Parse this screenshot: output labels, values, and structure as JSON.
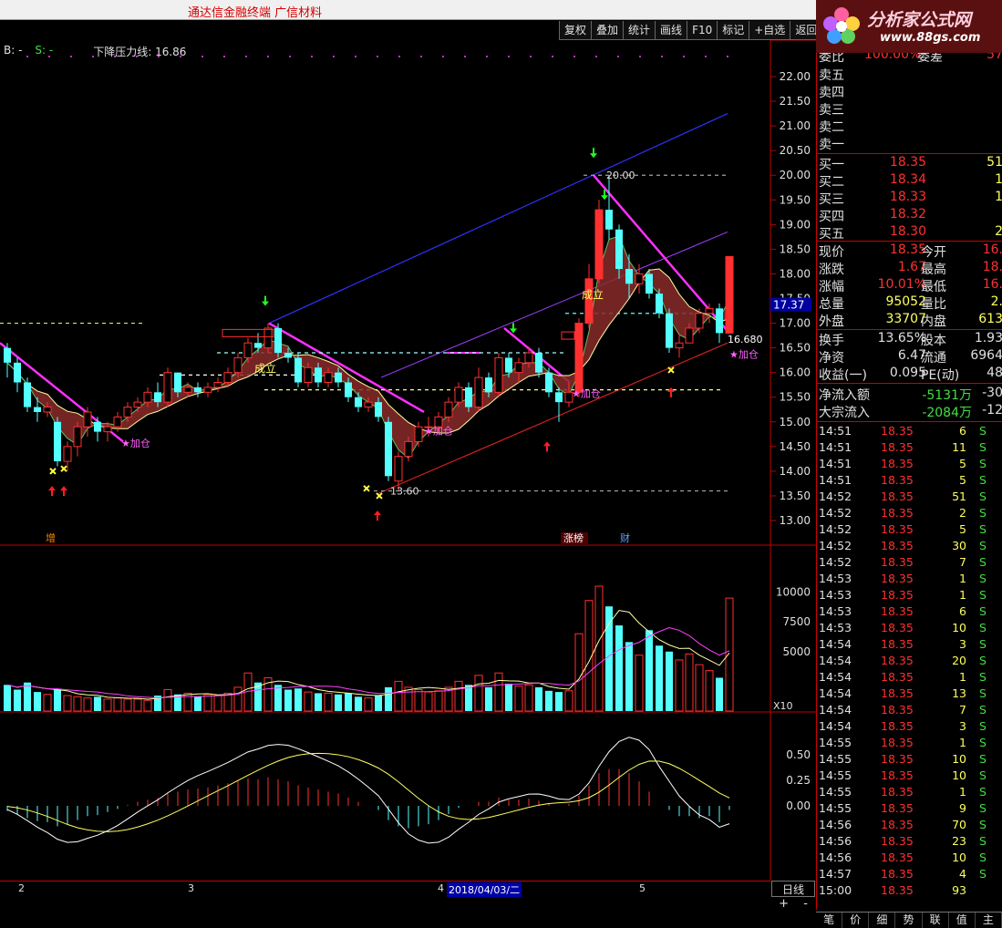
{
  "app": {
    "title": "通达信金融终端  广信材料"
  },
  "toolbar": [
    "复权",
    "叠加",
    "统计",
    "画线",
    "F10",
    "标记",
    "+自选",
    "返回"
  ],
  "logo": {
    "main": "分析家公式网",
    "url": "www.88gs.com"
  },
  "legend": {
    "b": "B: -",
    "s": "S: -",
    "line": "下降压力线: 16.86"
  },
  "price_axis": [
    "22.00",
    "21.50",
    "21.00",
    "20.50",
    "20.00",
    "19.50",
    "19.00",
    "18.50",
    "18.00",
    "17.50",
    "17.00",
    "16.50",
    "16.00",
    "15.50",
    "15.00",
    "14.50",
    "14.00",
    "13.50",
    "13.00"
  ],
  "current_price_tag": "17.37",
  "volume_axis": [
    "10000",
    "7500",
    "5000"
  ],
  "volume_unit": "X10",
  "macd_axis": [
    "0.50",
    "0.25",
    "0.00"
  ],
  "annotations": {
    "high": "20.00",
    "low": "13.60",
    "last": "16.680",
    "add_position": "★加仓",
    "established": "成立",
    "mark_zeng": "增",
    "mark_limit_up": "涨榜",
    "mark_cai": "财"
  },
  "dates": {
    "m2": "2",
    "m3": "3",
    "m4": "4",
    "cursor": "2018/04/03/二",
    "m5": "5"
  },
  "period": "日线",
  "zoom": {
    "plus": "+",
    "minus": "-"
  },
  "quote": {
    "weibi": {
      "label": "委比",
      "value": "100.00%",
      "label2": "委差",
      "value2": "57"
    },
    "sell": [
      {
        "label": "卖五"
      },
      {
        "label": "卖四"
      },
      {
        "label": "卖三"
      },
      {
        "label": "卖二"
      },
      {
        "label": "卖一"
      }
    ],
    "buy": [
      {
        "label": "买一",
        "price": "18.35",
        "vol": "51"
      },
      {
        "label": "买二",
        "price": "18.34",
        "vol": "1"
      },
      {
        "label": "买三",
        "price": "18.33",
        "vol": "1"
      },
      {
        "label": "买四",
        "price": "18.32",
        "vol": ""
      },
      {
        "label": "买五",
        "price": "18.30",
        "vol": "2"
      }
    ],
    "stats": [
      {
        "l1": "现价",
        "v1": "18.35",
        "l2": "今开",
        "v2": "16."
      },
      {
        "l1": "涨跌",
        "v1": "1.67",
        "l2": "最高",
        "v2": "18."
      },
      {
        "l1": "涨幅",
        "v1": "10.01%",
        "l2": "最低",
        "v2": "16."
      },
      {
        "l1": "总量",
        "v1": "95052",
        "l2": "量比",
        "v2": "2."
      },
      {
        "l1": "外盘",
        "v1": "33707",
        "l2": "内盘",
        "v2": "613"
      }
    ],
    "stats2": [
      {
        "l1": "换手",
        "v1": "13.65%",
        "l2": "股本",
        "v2": "1.93"
      },
      {
        "l1": "净资",
        "v1": "6.47",
        "l2": "流通",
        "v2": "6964"
      },
      {
        "l1": "收益(一)",
        "v1": "0.095",
        "l2": "PE(动)",
        "v2": "48"
      }
    ],
    "flow": [
      {
        "label": "净流入额",
        "value": "-5131万",
        "extra": "-30"
      },
      {
        "label": "大宗流入",
        "value": "-2084万",
        "extra": "-12"
      }
    ]
  },
  "ticks": [
    {
      "t": "14:51",
      "p": "18.35",
      "v": "6",
      "d": "S"
    },
    {
      "t": "14:51",
      "p": "18.35",
      "v": "11",
      "d": "S"
    },
    {
      "t": "14:51",
      "p": "18.35",
      "v": "5",
      "d": "S"
    },
    {
      "t": "14:51",
      "p": "18.35",
      "v": "5",
      "d": "S"
    },
    {
      "t": "14:52",
      "p": "18.35",
      "v": "51",
      "d": "S"
    },
    {
      "t": "14:52",
      "p": "18.35",
      "v": "2",
      "d": "S"
    },
    {
      "t": "14:52",
      "p": "18.35",
      "v": "5",
      "d": "S"
    },
    {
      "t": "14:52",
      "p": "18.35",
      "v": "30",
      "d": "S"
    },
    {
      "t": "14:52",
      "p": "18.35",
      "v": "7",
      "d": "S"
    },
    {
      "t": "14:53",
      "p": "18.35",
      "v": "1",
      "d": "S"
    },
    {
      "t": "14:53",
      "p": "18.35",
      "v": "1",
      "d": "S"
    },
    {
      "t": "14:53",
      "p": "18.35",
      "v": "6",
      "d": "S"
    },
    {
      "t": "14:53",
      "p": "18.35",
      "v": "10",
      "d": "S"
    },
    {
      "t": "14:54",
      "p": "18.35",
      "v": "3",
      "d": "S"
    },
    {
      "t": "14:54",
      "p": "18.35",
      "v": "20",
      "d": "S"
    },
    {
      "t": "14:54",
      "p": "18.35",
      "v": "1",
      "d": "S"
    },
    {
      "t": "14:54",
      "p": "18.35",
      "v": "13",
      "d": "S"
    },
    {
      "t": "14:54",
      "p": "18.35",
      "v": "7",
      "d": "S"
    },
    {
      "t": "14:54",
      "p": "18.35",
      "v": "3",
      "d": "S"
    },
    {
      "t": "14:55",
      "p": "18.35",
      "v": "1",
      "d": "S"
    },
    {
      "t": "14:55",
      "p": "18.35",
      "v": "10",
      "d": "S"
    },
    {
      "t": "14:55",
      "p": "18.35",
      "v": "10",
      "d": "S"
    },
    {
      "t": "14:55",
      "p": "18.35",
      "v": "1",
      "d": "S"
    },
    {
      "t": "14:55",
      "p": "18.35",
      "v": "9",
      "d": "S"
    },
    {
      "t": "14:56",
      "p": "18.35",
      "v": "70",
      "d": "S"
    },
    {
      "t": "14:56",
      "p": "18.35",
      "v": "23",
      "d": "S"
    },
    {
      "t": "14:56",
      "p": "18.35",
      "v": "10",
      "d": "S"
    },
    {
      "t": "14:57",
      "p": "18.35",
      "v": "4",
      "d": "S"
    },
    {
      "t": "15:00",
      "p": "18.35",
      "v": "93",
      "d": ""
    }
  ],
  "bottom_tabs": [
    "笔",
    "价",
    "细",
    "势",
    "联",
    "值",
    "主"
  ],
  "colors": {
    "up": "#ff3030",
    "down": "#54ffff",
    "axis": "#c00000",
    "text": "#e0e0e0"
  },
  "candles": [
    [
      16.5,
      16.2,
      16.6,
      15.9
    ],
    [
      16.2,
      15.8,
      16.3,
      15.6
    ],
    [
      15.8,
      15.3,
      15.9,
      15.2
    ],
    [
      15.3,
      15.2,
      15.5,
      15.0
    ],
    [
      15.2,
      15.3,
      15.4,
      15.1
    ],
    [
      15.0,
      14.2,
      15.1,
      14.1
    ],
    [
      14.2,
      14.5,
      14.6,
      14.0
    ],
    [
      14.5,
      14.9,
      15.0,
      14.3
    ],
    [
      14.9,
      15.2,
      15.3,
      14.7
    ],
    [
      15.0,
      14.8,
      15.1,
      14.6
    ],
    [
      14.8,
      14.9,
      15.0,
      14.6
    ],
    [
      14.9,
      15.1,
      15.2,
      14.8
    ],
    [
      15.1,
      15.3,
      15.4,
      15.0
    ],
    [
      15.3,
      15.4,
      15.5,
      15.2
    ],
    [
      15.4,
      15.6,
      15.7,
      15.3
    ],
    [
      15.6,
      15.4,
      15.8,
      15.3
    ],
    [
      15.4,
      16.0,
      16.1,
      15.3
    ],
    [
      16.0,
      15.6,
      16.0,
      15.5
    ],
    [
      15.6,
      15.7,
      15.8,
      15.5
    ],
    [
      15.7,
      15.6,
      15.8,
      15.5
    ],
    [
      15.6,
      15.7,
      15.8,
      15.5
    ],
    [
      15.7,
      15.8,
      15.9,
      15.6
    ],
    [
      15.8,
      16.0,
      16.1,
      15.7
    ],
    [
      16.0,
      16.3,
      16.4,
      15.9
    ],
    [
      16.3,
      16.6,
      16.7,
      16.2
    ],
    [
      16.6,
      16.5,
      16.8,
      16.4
    ],
    [
      16.5,
      16.9,
      17.0,
      16.4
    ],
    [
      16.9,
      16.4,
      17.0,
      16.3
    ],
    [
      16.4,
      16.3,
      16.5,
      16.2
    ],
    [
      16.3,
      15.8,
      16.4,
      15.7
    ],
    [
      15.8,
      16.1,
      16.2,
      15.7
    ],
    [
      16.1,
      15.8,
      16.2,
      15.7
    ],
    [
      15.8,
      16.0,
      16.1,
      15.7
    ],
    [
      16.0,
      15.8,
      16.1,
      15.7
    ],
    [
      15.8,
      15.5,
      15.9,
      15.4
    ],
    [
      15.5,
      15.3,
      15.6,
      15.2
    ],
    [
      15.3,
      15.4,
      15.5,
      15.2
    ],
    [
      15.4,
      15.1,
      15.5,
      15.0
    ],
    [
      15.0,
      13.9,
      15.1,
      13.8
    ],
    [
      13.8,
      14.3,
      14.4,
      13.6
    ],
    [
      14.3,
      14.6,
      14.7,
      14.2
    ],
    [
      14.6,
      14.9,
      15.0,
      14.5
    ],
    [
      14.9,
      14.9,
      15.1,
      14.7
    ],
    [
      14.9,
      15.1,
      15.2,
      14.8
    ],
    [
      15.1,
      15.4,
      15.5,
      15.0
    ],
    [
      15.4,
      15.7,
      15.8,
      15.3
    ],
    [
      15.7,
      15.3,
      15.8,
      15.2
    ],
    [
      15.3,
      15.9,
      16.1,
      15.2
    ],
    [
      15.9,
      15.6,
      16.0,
      15.5
    ],
    [
      15.6,
      16.3,
      16.4,
      15.5
    ],
    [
      16.3,
      16.0,
      16.4,
      15.9
    ],
    [
      16.0,
      16.2,
      16.3,
      15.8
    ],
    [
      16.2,
      16.4,
      16.5,
      16.1
    ],
    [
      16.4,
      16.0,
      16.5,
      15.9
    ],
    [
      16.0,
      15.6,
      16.1,
      15.5
    ],
    [
      15.6,
      15.4,
      15.7,
      15.0
    ],
    [
      15.4,
      15.6,
      15.8,
      15.3
    ],
    [
      15.6,
      17.0,
      17.1,
      15.5
    ],
    [
      17.0,
      17.9,
      18.2,
      16.9
    ],
    [
      17.9,
      19.3,
      19.5,
      17.8
    ],
    [
      19.3,
      18.9,
      20.0,
      18.7
    ],
    [
      18.9,
      18.1,
      19.0,
      17.9
    ],
    [
      18.1,
      17.8,
      18.4,
      17.5
    ],
    [
      17.8,
      18.0,
      18.2,
      17.6
    ],
    [
      18.0,
      17.6,
      18.1,
      17.5
    ],
    [
      17.6,
      17.2,
      17.7,
      17.1
    ],
    [
      17.2,
      16.5,
      17.3,
      16.4
    ],
    [
      16.5,
      16.6,
      16.8,
      16.3
    ],
    [
      16.6,
      16.9,
      17.0,
      16.6
    ],
    [
      16.9,
      17.2,
      17.3,
      16.8
    ],
    [
      17.2,
      17.3,
      17.4,
      17.0
    ],
    [
      17.3,
      16.8,
      17.4,
      16.6
    ],
    [
      16.8,
      18.35,
      18.35,
      16.8
    ]
  ],
  "volumes": [
    2200,
    1800,
    2400,
    1600,
    1400,
    1800,
    1300,
    1200,
    1100,
    1200,
    1000,
    1100,
    1000,
    1000,
    900,
    1300,
    1800,
    1400,
    1500,
    1200,
    1400,
    1300,
    1500,
    2000,
    3200,
    2400,
    2800,
    2200,
    1800,
    1900,
    1600,
    1500,
    1500,
    1400,
    1500,
    1200,
    1100,
    1300,
    2000,
    2500,
    2000,
    1800,
    1600,
    1700,
    2000,
    2500,
    2200,
    3000,
    2000,
    3200,
    2300,
    2100,
    2200,
    2000,
    1700,
    1600,
    1700,
    6500,
    9300,
    10500,
    8800,
    7200,
    5800,
    4700,
    6800,
    5500,
    5000,
    4300,
    4800,
    3900,
    3400,
    2800,
    9500
  ],
  "macd": [
    -0.05,
    -0.08,
    -0.12,
    -0.15,
    -0.16,
    -0.2,
    -0.18,
    -0.14,
    -0.1,
    -0.09,
    -0.06,
    -0.03,
    0.01,
    0.04,
    0.06,
    0.08,
    0.12,
    0.14,
    0.16,
    0.17,
    0.18,
    0.2,
    0.22,
    0.25,
    0.27,
    0.26,
    0.28,
    0.26,
    0.24,
    0.2,
    0.18,
    0.16,
    0.14,
    0.12,
    0.08,
    0.04,
    0.0,
    -0.04,
    -0.14,
    -0.2,
    -0.22,
    -0.2,
    -0.18,
    -0.14,
    -0.08,
    -0.02,
    0.0,
    0.04,
    0.04,
    0.08,
    0.06,
    0.06,
    0.07,
    0.05,
    0.02,
    0.0,
    0.02,
    0.1,
    0.2,
    0.32,
    0.36,
    0.36,
    0.32,
    0.24,
    0.14,
    0.0,
    -0.04,
    -0.1,
    -0.1,
    -0.12,
    -0.1,
    -0.16,
    -0.04
  ]
}
